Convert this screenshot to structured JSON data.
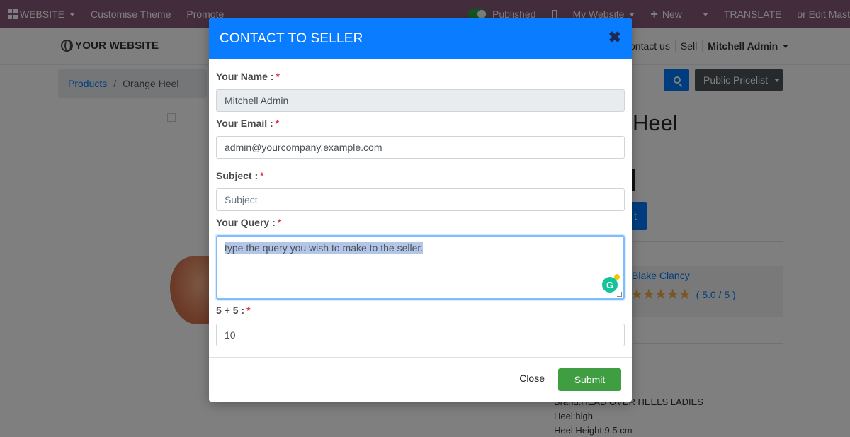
{
  "topbar": {
    "website_menu": "WEBSITE",
    "customise_theme": "Customise Theme",
    "promote": "Promote",
    "published": "Published",
    "my_website": "My Website",
    "new": "New",
    "translate": "TRANSLATE",
    "edit_master": "or Edit Master"
  },
  "navbar": {
    "brand": "YOUR WEBSITE",
    "contact_us": "ontact us",
    "sell": "Sell",
    "user": "Mitchell Admin"
  },
  "breadcrumb": {
    "products": "Products",
    "separator": "/",
    "current": "Orange Heel"
  },
  "product": {
    "name_fragment": "Heel",
    "cart_fragment": "t",
    "pricelist": "Public Pricelist",
    "seller_name": "Blake Clancy",
    "stars": "★★★★★",
    "rating": "( 5.0 / 5 )",
    "specs": [
      "Brand:HEAD OVER HEELS LADIES",
      "Heel:high",
      "Heel Height:9.5 cm"
    ]
  },
  "modal": {
    "title": "CONTACT TO SELLER",
    "close_icon": "✖",
    "required_mark": "*",
    "name_label": "Your Name :",
    "name_value": "Mitchell Admin",
    "email_label": "Your Email :",
    "email_value": "admin@yourcompany.example.com",
    "subject_label": "Subject :",
    "subject_placeholder": "Subject",
    "query_label": "Your Query :",
    "query_value": "type the query you wish to make to the seller.",
    "captcha_label": "5 + 5 :",
    "captcha_value": "10",
    "close_button": "Close",
    "submit_button": "Submit"
  },
  "icons": {
    "grammarly": "G"
  },
  "colors": {
    "topbar": "#875a7b",
    "modal_header": "#0a7cff",
    "submit": "#3f9e41",
    "required": "#dc3545"
  }
}
